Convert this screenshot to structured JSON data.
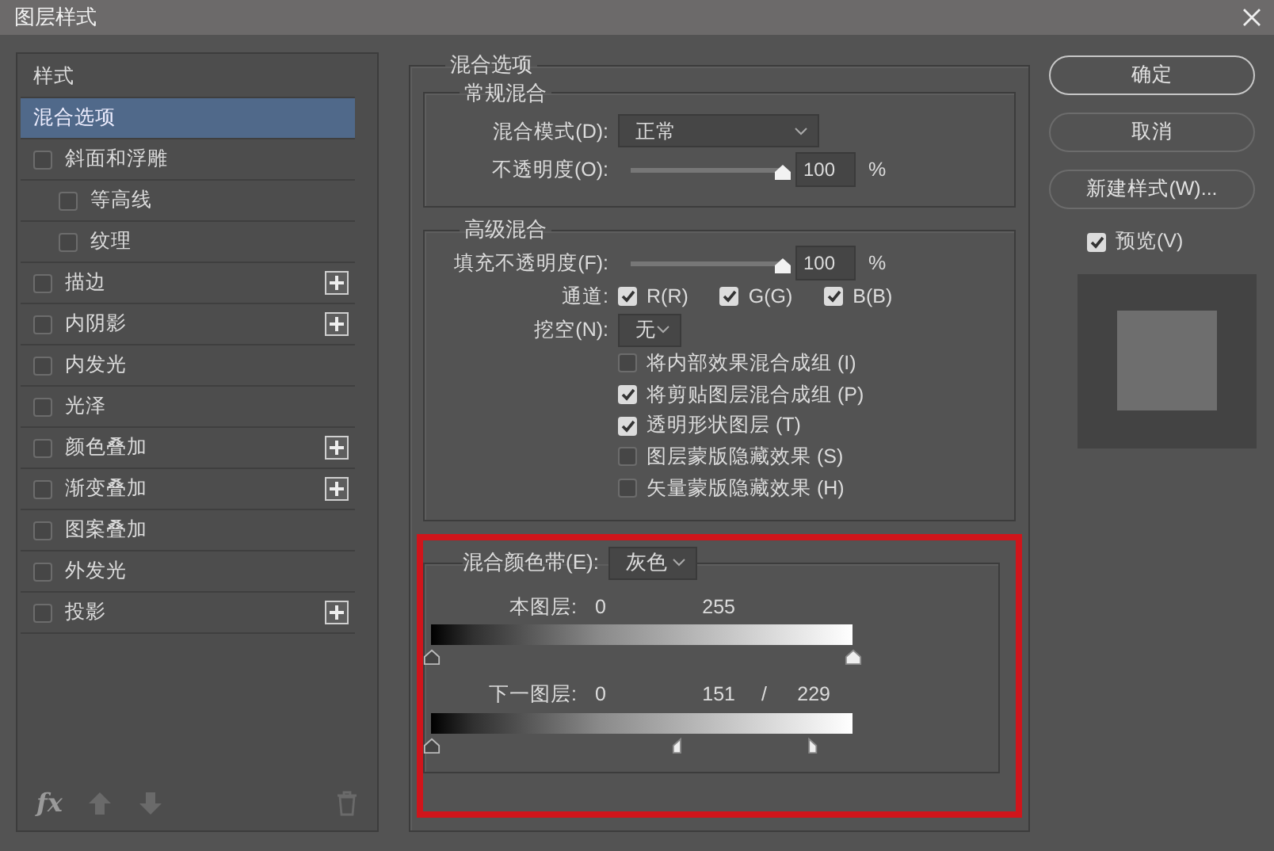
{
  "window": {
    "title": "图层样式"
  },
  "sidebar": {
    "header": "样式",
    "items": [
      {
        "label": "混合选项",
        "kind": "plain",
        "selected": true
      },
      {
        "label": "斜面和浮雕",
        "kind": "check",
        "selected": false,
        "checked": false,
        "add_button": false,
        "children": [
          {
            "label": "等高线",
            "kind": "check",
            "selected": false,
            "checked": false,
            "add_button": false
          },
          {
            "label": "纹理",
            "kind": "check",
            "selected": false,
            "checked": false,
            "add_button": false
          }
        ]
      },
      {
        "label": "描边",
        "kind": "check",
        "selected": false,
        "checked": false,
        "add_button": true
      },
      {
        "label": "内阴影",
        "kind": "check",
        "selected": false,
        "checked": false,
        "add_button": true
      },
      {
        "label": "内发光",
        "kind": "check",
        "selected": false,
        "checked": false,
        "add_button": false
      },
      {
        "label": "光泽",
        "kind": "check",
        "selected": false,
        "checked": false,
        "add_button": false
      },
      {
        "label": "颜色叠加",
        "kind": "check",
        "selected": false,
        "checked": false,
        "add_button": true
      },
      {
        "label": "渐变叠加",
        "kind": "check",
        "selected": false,
        "checked": false,
        "add_button": true
      },
      {
        "label": "图案叠加",
        "kind": "check",
        "selected": false,
        "checked": false,
        "add_button": false
      },
      {
        "label": "外发光",
        "kind": "check",
        "selected": false,
        "checked": false,
        "add_button": false
      },
      {
        "label": "投影",
        "kind": "check",
        "selected": false,
        "checked": false,
        "add_button": true
      }
    ],
    "toolbar": {
      "fx": "fx"
    }
  },
  "blending": {
    "title": "混合选项",
    "general": {
      "title": "常规混合",
      "mode_label": "混合模式(D):",
      "mode_value": "正常",
      "opacity_label": "不透明度(O):",
      "opacity": {
        "level": 1,
        "value": "100",
        "unit": "%"
      }
    },
    "advanced": {
      "title": "高级混合",
      "fill_label": "填充不透明度(F):",
      "fill": {
        "level": 1,
        "value": "100",
        "unit": "%"
      },
      "channels_label": "通道:",
      "channels": [
        {
          "label": "R(R)",
          "checked": true
        },
        {
          "label": "G(G)",
          "checked": true
        },
        {
          "label": "B(B)",
          "checked": true
        }
      ],
      "knockout_label": "挖空(N):",
      "knockout_value": "无",
      "options": [
        {
          "label": "将内部效果混合成组 (I)",
          "checked": false
        },
        {
          "label": "将剪贴图层混合成组 (P)",
          "checked": true
        },
        {
          "label": "透明形状图层 (T)",
          "checked": true
        },
        {
          "label": "图层蒙版隐藏效果 (S)",
          "checked": false
        },
        {
          "label": "矢量蒙版隐藏效果 (H)",
          "checked": false
        }
      ]
    },
    "blend_if": {
      "label": "混合颜色带(E):",
      "value": "灰色",
      "annotation": {
        "kind": "frame"
      },
      "layers": [
        {
          "label": "本图层:",
          "readings": [
            "0",
            "255"
          ],
          "thumbs": [
            {
              "kind": "dark",
              "level": 0
            },
            {
              "kind": "light",
              "level": 1
            }
          ]
        },
        {
          "label": "下一图层:",
          "readings": [
            "0",
            "151",
            "/",
            "229"
          ],
          "thumbs": [
            {
              "kind": "dark",
              "level": 0
            },
            {
              "kind": "light-left",
              "level": 0.59
            },
            {
              "kind": "light-right",
              "level": 0.9
            }
          ]
        }
      ]
    }
  },
  "buttons": [
    {
      "label": "确定",
      "default": true
    },
    {
      "label": "取消",
      "default": false
    },
    {
      "label": "新建样式(W)...",
      "default": false
    }
  ],
  "preview": {
    "label": "预览(V)",
    "checked": true
  }
}
